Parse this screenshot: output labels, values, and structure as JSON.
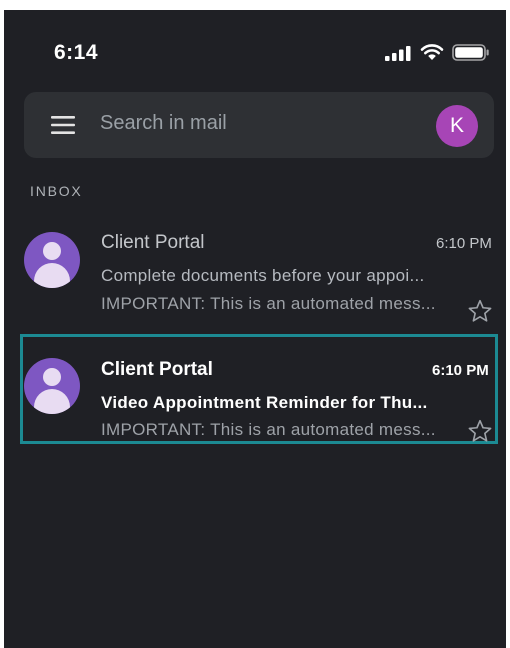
{
  "status_bar": {
    "time": "6:14",
    "icons": [
      "cellular-signal-icon",
      "wifi-icon",
      "battery-icon"
    ]
  },
  "search": {
    "menu_icon": "hamburger-menu-icon",
    "placeholder": "Search in mail",
    "account_initial": "K",
    "account_color": "#a745b6"
  },
  "inbox": {
    "label": "INBOX",
    "emails": [
      {
        "sender": "Client Portal",
        "time": "6:10 PM",
        "subject": "Complete documents before your appoi...",
        "preview": "IMPORTANT: This is an automated mess...",
        "unread": false,
        "starred": false
      },
      {
        "sender": "Client Portal",
        "time": "6:10 PM",
        "subject": "Video Appointment Reminder for Thu...",
        "preview": "IMPORTANT: This is an automated mess...",
        "unread": true,
        "starred": false,
        "highlighted": true
      }
    ]
  },
  "colors": {
    "background": "#1f2025",
    "search_bar": "#2e3034",
    "sender_avatar": "#7e57c2",
    "highlight_border": "#1c8a93"
  }
}
